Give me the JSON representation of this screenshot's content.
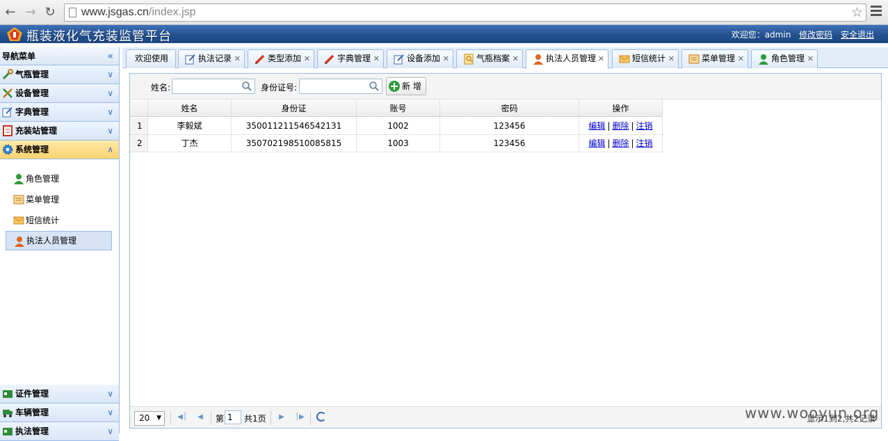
{
  "browser": {
    "url_domain": "www.jsgas.cn",
    "url_path": "/index.jsp"
  },
  "header": {
    "title": "瓶装液化气充装监管平台",
    "welcome": "欢迎您：admin",
    "change_password": "修改密码",
    "logout": "安全退出"
  },
  "sidebar": {
    "title": "导航菜单",
    "groups": [
      {
        "label": "气瓶管理",
        "icon": "wrench-icon"
      },
      {
        "label": "设备管理",
        "icon": "tools-icon"
      },
      {
        "label": "字典管理",
        "icon": "edit-icon"
      },
      {
        "label": "充装站管理",
        "icon": "station-icon"
      },
      {
        "label": "系统管理",
        "icon": "gear-icon",
        "expanded": true
      }
    ],
    "sub_items": [
      {
        "label": "角色管理",
        "icon": "user-green-icon"
      },
      {
        "label": "菜单管理",
        "icon": "menu-icon"
      },
      {
        "label": "短信统计",
        "icon": "envelope-icon"
      },
      {
        "label": "执法人员管理",
        "icon": "user-orange-icon",
        "selected": true
      }
    ],
    "bottom_groups": [
      {
        "label": "证件管理",
        "icon": "card-icon"
      },
      {
        "label": "车辆管理",
        "icon": "truck-icon"
      },
      {
        "label": "执法管理",
        "icon": "card-icon"
      }
    ]
  },
  "tabs": [
    {
      "label": "欢迎使用",
      "icon": "",
      "closable": false
    },
    {
      "label": "执法记录",
      "icon": "edit-icon",
      "closable": true
    },
    {
      "label": "类型添加",
      "icon": "pencil-icon",
      "closable": true
    },
    {
      "label": "字典管理",
      "icon": "pencil-icon",
      "closable": true
    },
    {
      "label": "设备添加",
      "icon": "edit-icon",
      "closable": true
    },
    {
      "label": "气瓶档案",
      "icon": "search-doc-icon",
      "closable": true
    },
    {
      "label": "执法人员管理",
      "icon": "user-orange-icon",
      "closable": true,
      "active": true
    },
    {
      "label": "短信统计",
      "icon": "envelope-icon",
      "closable": true
    },
    {
      "label": "菜单管理",
      "icon": "menu-icon",
      "closable": true
    },
    {
      "label": "角色管理",
      "icon": "user-green-icon",
      "closable": true
    }
  ],
  "toolbar": {
    "name_label": "姓名:",
    "name_value": "",
    "id_label": "身份证号:",
    "id_value": "",
    "add_label": "新 增"
  },
  "table": {
    "columns": [
      "姓名",
      "身份证",
      "账号",
      "密码",
      "操作"
    ],
    "rows": [
      {
        "num": "1",
        "name": "李毅斌",
        "id_card": "350011211546542131",
        "account": "1002",
        "password": "123456"
      },
      {
        "num": "2",
        "name": "丁杰",
        "id_card": "350702198510085815",
        "account": "1003",
        "password": "123456"
      }
    ],
    "actions": {
      "edit": "编辑",
      "delete": "删除",
      "cancel": "注销",
      "sep": "|"
    }
  },
  "pager": {
    "page_size": "20",
    "page_prefix": "第",
    "current_page": "1",
    "total_pages": "共1页",
    "info": "显示1到2,共2记录"
  },
  "watermark": "www.wooyun.org",
  "colors": {
    "header_blue": "#22508f",
    "border_blue": "#99bbe8",
    "active_group": "#fbd36f",
    "link_blue": "#0000cc"
  }
}
